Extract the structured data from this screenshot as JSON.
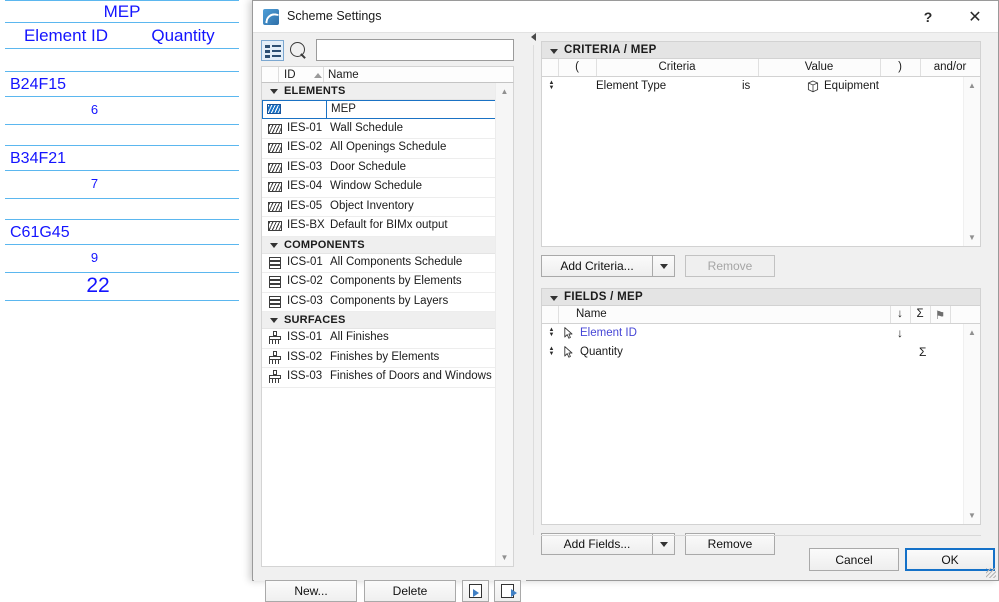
{
  "schedule_preview": {
    "title": "MEP",
    "columns": [
      "Element ID",
      "Quantity"
    ],
    "rows": [
      {
        "id": "B24F15",
        "quantity": "6"
      },
      {
        "id": "B34F21",
        "quantity": "7"
      },
      {
        "id": "C61G45",
        "quantity": "9"
      }
    ],
    "total": "22"
  },
  "dialog": {
    "title": "Scheme Settings",
    "help_label": "?",
    "close_label": "✕"
  },
  "search": {
    "value": "",
    "placeholder": ""
  },
  "list": {
    "header": {
      "id": "ID",
      "name": "Name"
    },
    "groups": [
      {
        "label": "ELEMENTS",
        "items": [
          {
            "id": "",
            "name": "MEP",
            "icon": "schedule-icon",
            "editing": true,
            "selected": true
          },
          {
            "id": "IES-01",
            "name": "Wall Schedule",
            "icon": "schedule-icon"
          },
          {
            "id": "IES-02",
            "name": "All Openings Schedule",
            "icon": "schedule-icon"
          },
          {
            "id": "IES-03",
            "name": "Door Schedule",
            "icon": "schedule-icon"
          },
          {
            "id": "IES-04",
            "name": "Window Schedule",
            "icon": "schedule-icon"
          },
          {
            "id": "IES-05",
            "name": "Object Inventory",
            "icon": "schedule-icon"
          },
          {
            "id": "IES-BX",
            "name": "Default for BIMx output",
            "icon": "schedule-icon"
          }
        ]
      },
      {
        "label": "COMPONENTS",
        "items": [
          {
            "id": "ICS-01",
            "name": "All Components Schedule",
            "icon": "components-icon"
          },
          {
            "id": "ICS-02",
            "name": "Components by Elements",
            "icon": "components-icon"
          },
          {
            "id": "ICS-03",
            "name": "Components by Layers",
            "icon": "components-icon"
          }
        ]
      },
      {
        "label": "SURFACES",
        "items": [
          {
            "id": "ISS-01",
            "name": "All Finishes",
            "icon": "surfaces-icon"
          },
          {
            "id": "ISS-02",
            "name": "Finishes by Elements",
            "icon": "surfaces-icon"
          },
          {
            "id": "ISS-03",
            "name": "Finishes of Doors and Windows",
            "icon": "surfaces-icon"
          }
        ]
      }
    ],
    "buttons": {
      "new": "New...",
      "delete": "Delete",
      "import": "import-scheme-icon",
      "export": "export-scheme-icon"
    }
  },
  "criteria_panel": {
    "title": "CRITERIA /  MEP",
    "columns": [
      "(",
      "Criteria",
      "Value",
      ")",
      "and/or"
    ],
    "rows": [
      {
        "name": "Element Type",
        "operator": "is",
        "value": "Equipment",
        "value_icon": "equipment-icon"
      }
    ],
    "buttons": {
      "add": "Add Criteria...",
      "remove": "Remove",
      "remove_disabled": true
    }
  },
  "fields_panel": {
    "title": "FIELDS /  MEP",
    "columns": [
      "Name",
      "↓",
      "Σ",
      "flag"
    ],
    "rows": [
      {
        "name": "Element ID",
        "sort": "↓",
        "sum": "",
        "highlighted": true
      },
      {
        "name": "Quantity",
        "sort": "",
        "sum": "Σ",
        "highlighted": false
      }
    ],
    "buttons": {
      "add": "Add Fields...",
      "remove": "Remove"
    }
  },
  "footer": {
    "cancel": "Cancel",
    "ok": "OK"
  },
  "colors": {
    "schedule_text": "#1414ff",
    "schedule_rule": "#5bb7ef",
    "accent": "#1471c8",
    "dialog_bg": "#f0f0f0"
  }
}
